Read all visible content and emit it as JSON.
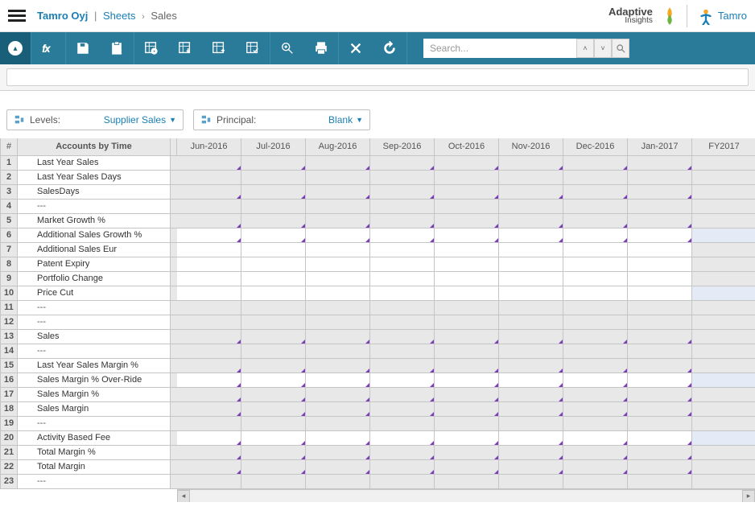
{
  "header": {
    "company": "Tamro Oyj",
    "section": "Sheets",
    "current": "Sales",
    "logo1_main": "Adaptive",
    "logo1_sub": "Insights",
    "logo2": "Tamro"
  },
  "toolbar": {
    "search_placeholder": "Search..."
  },
  "dropdowns": {
    "levels_label": "Levels:",
    "levels_value": "Supplier Sales",
    "principal_label": "Principal:",
    "principal_value": "Blank"
  },
  "grid": {
    "rownum_header": "#",
    "accounts_header": "Accounts by Time",
    "columns": [
      "Jun-2016",
      "Jul-2016",
      "Aug-2016",
      "Sep-2016",
      "Oct-2016",
      "Nov-2016",
      "Dec-2016",
      "Jan-2017",
      "FY2017"
    ],
    "rows": [
      {
        "n": 1,
        "label": "Last Year Sales",
        "bg": "grey",
        "marker": true,
        "fy": "grey"
      },
      {
        "n": 2,
        "label": "Last Year Sales Days",
        "bg": "grey",
        "marker": false,
        "fy": "grey"
      },
      {
        "n": 3,
        "label": "SalesDays",
        "bg": "grey",
        "marker": true,
        "fy": "grey"
      },
      {
        "n": 4,
        "label": "---",
        "bg": "grey",
        "marker": false,
        "fy": "grey"
      },
      {
        "n": 5,
        "label": "Market Growth %",
        "bg": "grey",
        "marker": true,
        "fy": "grey"
      },
      {
        "n": 6,
        "label": "Additional Sales Growth %",
        "bg": "white",
        "marker": true,
        "fy": "lightblue"
      },
      {
        "n": 7,
        "label": "Additional Sales Eur",
        "bg": "white",
        "marker": false,
        "fy": "grey"
      },
      {
        "n": 8,
        "label": "Patent Expiry",
        "bg": "white",
        "marker": false,
        "fy": "grey"
      },
      {
        "n": 9,
        "label": "Portfolio Change",
        "bg": "white",
        "marker": false,
        "fy": "grey"
      },
      {
        "n": 10,
        "label": "Price Cut",
        "bg": "white",
        "marker": false,
        "fy": "lightblue"
      },
      {
        "n": 11,
        "label": "---",
        "bg": "grey",
        "marker": false,
        "fy": "grey"
      },
      {
        "n": 12,
        "label": "---",
        "bg": "grey",
        "marker": false,
        "fy": "grey"
      },
      {
        "n": 13,
        "label": "Sales",
        "bg": "grey",
        "marker": true,
        "fy": "grey"
      },
      {
        "n": 14,
        "label": "---",
        "bg": "grey",
        "marker": false,
        "fy": "grey"
      },
      {
        "n": 15,
        "label": "Last Year Sales Margin %",
        "bg": "grey",
        "marker": true,
        "fy": "grey"
      },
      {
        "n": 16,
        "label": "Sales Margin % Over-Ride",
        "bg": "white",
        "marker": true,
        "fy": "lightblue"
      },
      {
        "n": 17,
        "label": "Sales Margin %",
        "bg": "grey",
        "marker": true,
        "fy": "grey"
      },
      {
        "n": 18,
        "label": "Sales Margin",
        "bg": "grey",
        "marker": true,
        "fy": "grey"
      },
      {
        "n": 19,
        "label": "---",
        "bg": "grey",
        "marker": false,
        "fy": "grey"
      },
      {
        "n": 20,
        "label": "Activity Based Fee",
        "bg": "white",
        "marker": true,
        "fy": "lightblue"
      },
      {
        "n": 21,
        "label": "Total Margin %",
        "bg": "grey",
        "marker": true,
        "fy": "grey"
      },
      {
        "n": 22,
        "label": "Total Margin",
        "bg": "grey",
        "marker": true,
        "fy": "grey"
      },
      {
        "n": 23,
        "label": "---",
        "bg": "grey",
        "marker": false,
        "fy": "grey"
      }
    ]
  }
}
